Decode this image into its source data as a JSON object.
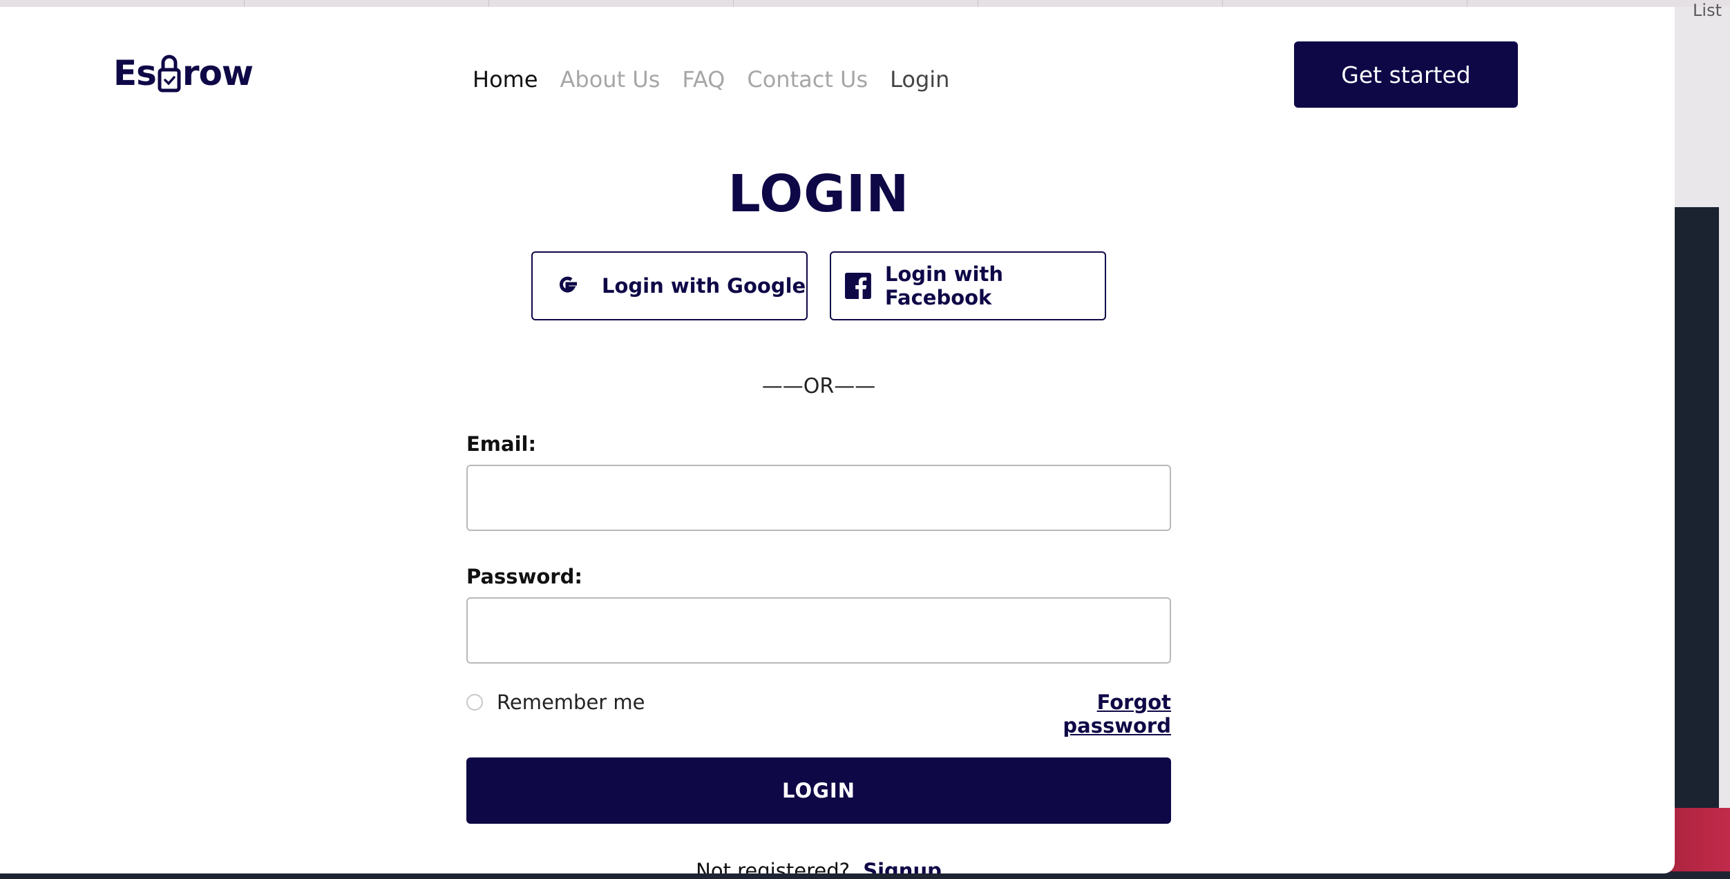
{
  "browser": {
    "tab_peek_text": "List"
  },
  "logo": {
    "text_left": "Es",
    "text_right": "row"
  },
  "nav": {
    "items": [
      {
        "label": "Home"
      },
      {
        "label": "About Us"
      },
      {
        "label": "FAQ"
      },
      {
        "label": "Contact Us"
      },
      {
        "label": "Login"
      }
    ],
    "cta_label": "Get started"
  },
  "login": {
    "title": "LOGIN",
    "google_label": "Login with Google",
    "facebook_label": "Login with Facebook",
    "or_text": "——OR——",
    "email_label": "Email:",
    "email_value": "",
    "password_label": "Password:",
    "password_value": "",
    "remember_label": "Remember me",
    "forgot_label": "Forgot password",
    "submit_label": "LOGIN",
    "not_registered": "Not registered?",
    "signup_label": "Signup"
  },
  "colors": {
    "brand": "#0e0847",
    "nav_active": "#111111",
    "nav_inactive": "#a6a6a6"
  },
  "icons": {
    "google": "google-icon",
    "facebook": "facebook-icon",
    "logo_lock": "lock-icon"
  }
}
